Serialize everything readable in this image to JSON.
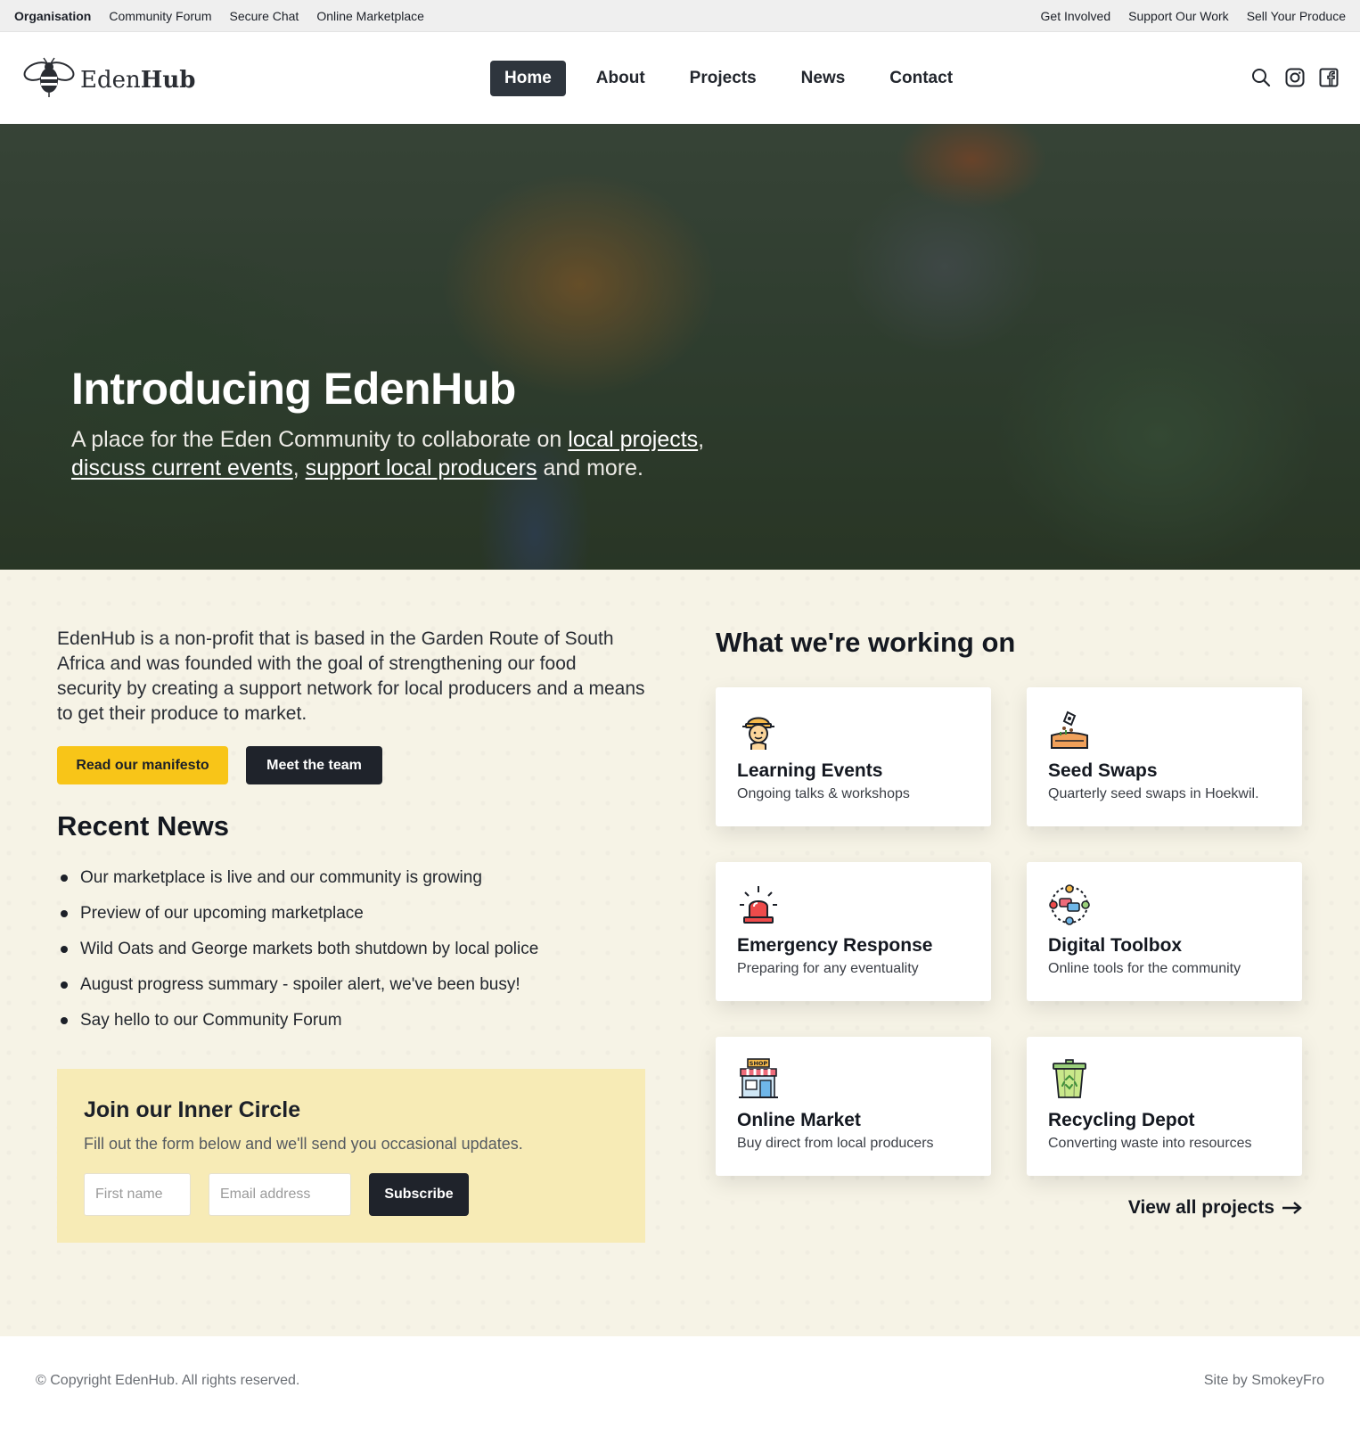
{
  "topbar": {
    "left": [
      "Organisation",
      "Community Forum",
      "Secure Chat",
      "Online Marketplace"
    ],
    "right": [
      "Get Involved",
      "Support Our Work",
      "Sell Your Produce"
    ]
  },
  "header": {
    "logo_light": "Eden",
    "logo_bold": "Hub",
    "nav": [
      "Home",
      "About",
      "Projects",
      "News",
      "Contact"
    ],
    "active_nav": "Home",
    "icons": [
      "search-icon",
      "instagram-icon",
      "facebook-icon"
    ]
  },
  "hero": {
    "title": "Introducing EdenHub",
    "sub_1": "A place for the Eden Community to collaborate on ",
    "link_1": "local projects",
    "sub_2": ",",
    "link_2": "discuss current events",
    "sub_3": ", ",
    "link_3": "support local producers",
    "sub_4": " and more."
  },
  "intro": {
    "text": "EdenHub is a non-profit that is based in the Garden Route of South Africa and was founded with the goal of strengthening our food security by creating a support network for local producers and a means to get their produce to market.",
    "manifesto_button": "Read our manifesto",
    "team_button": "Meet the team"
  },
  "news": {
    "title": "Recent News",
    "items": [
      "Our marketplace is live and our community is growing",
      "Preview of our upcoming marketplace",
      "Wild Oats and George markets both shutdown by local police",
      "August progress summary - spoiler alert, we've been busy!",
      "Say hello to our Community Forum"
    ]
  },
  "join": {
    "title": "Join our Inner Circle",
    "subtitle": "Fill out the form below and we'll send you occasional updates.",
    "first_name_placeholder": "First name",
    "email_placeholder": "Email address",
    "subscribe_label": "Subscribe"
  },
  "work": {
    "title": "What we're working on",
    "cards": [
      {
        "title": "Learning Events",
        "subtitle": "Ongoing talks & workshops",
        "icon": "brain-worker-icon"
      },
      {
        "title": "Seed Swaps",
        "subtitle": "Quarterly seed swaps in Hoekwil.",
        "icon": "seedling-soil-icon"
      },
      {
        "title": "Emergency Response",
        "subtitle": "Preparing for any eventuality",
        "icon": "siren-icon"
      },
      {
        "title": "Digital Toolbox",
        "subtitle": "Online tools for the community",
        "icon": "network-chat-icon"
      },
      {
        "title": "Online Market",
        "subtitle": "Buy direct from local producers",
        "icon": "shop-icon"
      },
      {
        "title": "Recycling Depot",
        "subtitle": "Converting waste into resources",
        "icon": "recycling-bin-icon"
      }
    ],
    "shop_sign": "SHOP",
    "view_all": "View all projects"
  },
  "footer": {
    "copyright": "© Copyright EdenHub. All rights reserved.",
    "credit_prefix": "Site by ",
    "credit_name": "SmokeyFro"
  },
  "colors": {
    "accent_yellow": "#f8c518",
    "dark": "#1f232b",
    "cream_bg": "#f6f3e6",
    "join_bg": "#f7ebb6"
  }
}
